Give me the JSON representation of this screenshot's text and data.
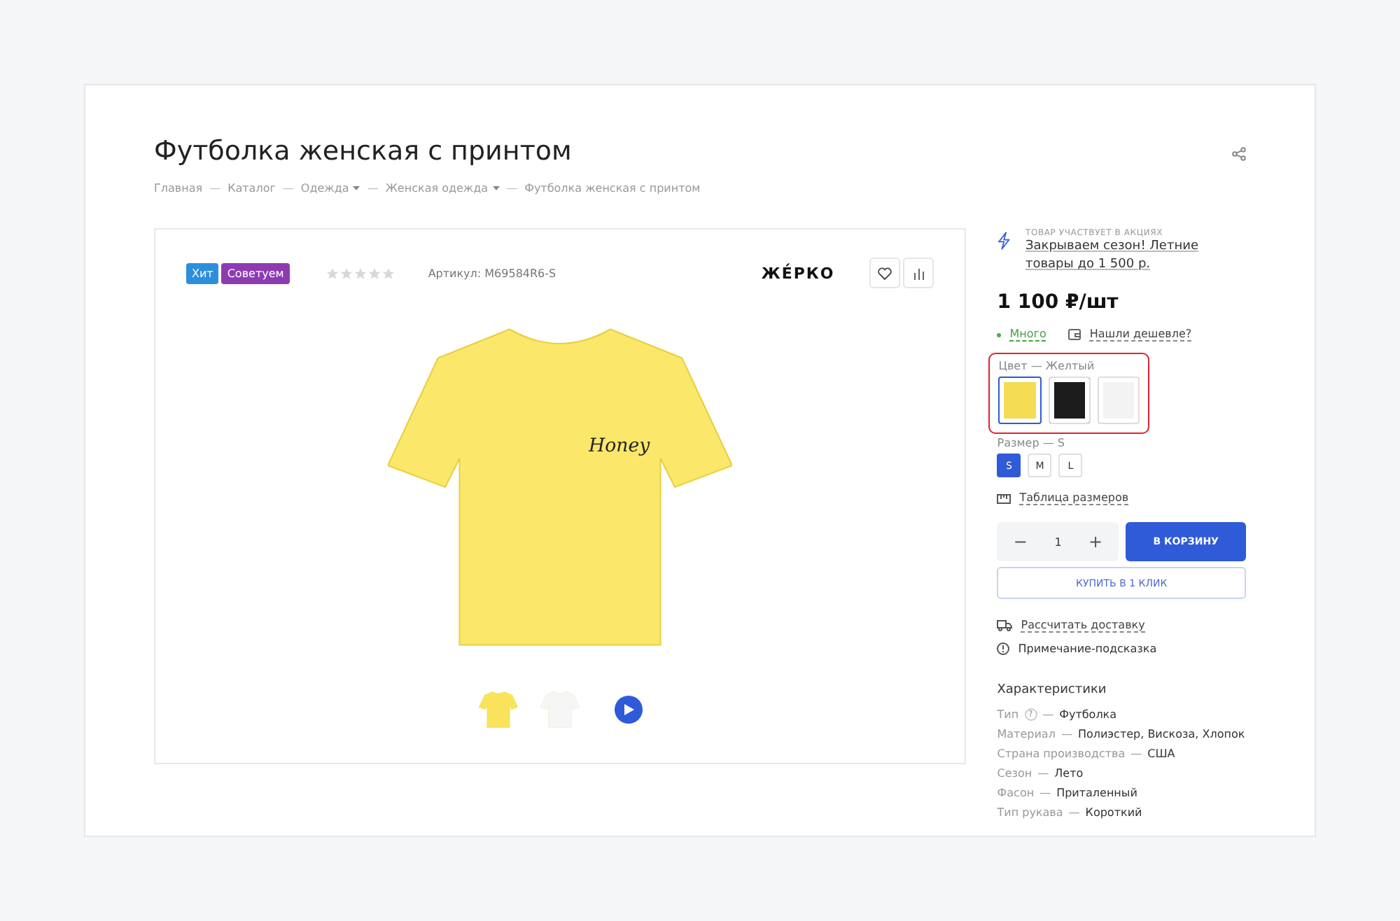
{
  "title": "Футболка женская с принтом",
  "breadcrumbs": [
    {
      "label": "Главная",
      "dropdown": false
    },
    {
      "separator": "—",
      "label": "Каталог",
      "dropdown": false
    },
    {
      "separator": "—",
      "label": "Одежда",
      "dropdown": true
    },
    {
      "separator": "—",
      "label": "Женская одежда",
      "dropdown": true
    },
    {
      "separator": "—",
      "label": "Футболка женская с принтом",
      "dropdown": false
    }
  ],
  "badges": [
    {
      "label": "Хит",
      "color": "#2d8fdc"
    },
    {
      "label": "Советуем",
      "color": "#8e3bb3"
    }
  ],
  "rating": {
    "stars": 0
  },
  "article": "Артикул: M69584R6-S",
  "brand": "ЖЕ́РКО",
  "product_image": {
    "print_text": "Honey"
  },
  "thumbnails": [
    {
      "kind": "image",
      "color": "#f8e35a",
      "selected": false
    },
    {
      "kind": "image",
      "color": "#f6f6f6",
      "selected": false
    },
    {
      "kind": "video",
      "selected": false
    }
  ],
  "promo": {
    "caption": "ТОВАР УЧАСТВУЕТ В АКЦИЯХ",
    "link": "Закрываем сезон! Летние товары до 1 500 р."
  },
  "price": "1 100 ₽/шт",
  "stock": "Много",
  "cheaper_link": "Нашли дешевле?",
  "color_option": {
    "label": "Цвет",
    "separator": "—",
    "value": "Желтый",
    "highlighted": true,
    "swatches": [
      {
        "color": "#f4dc54",
        "selected": true
      },
      {
        "color": "#1c1c1c",
        "selected": false
      },
      {
        "color": "#f3f3f3",
        "selected": false
      }
    ]
  },
  "size_option": {
    "label": "Размер",
    "separator": "—",
    "value": "S",
    "sizes": [
      {
        "label": "S",
        "selected": true
      },
      {
        "label": "M",
        "selected": false
      },
      {
        "label": "L",
        "selected": false
      }
    ]
  },
  "size_table_link": "Таблица размеров",
  "quantity": {
    "minus": "−",
    "value": "1",
    "plus": "+"
  },
  "cart_button": "В КОРЗИНУ",
  "one_click_button": "КУПИТЬ В 1 КЛИК",
  "delivery_link": "Рассчитать доставку",
  "hint_note": "Примечание-подсказка",
  "characteristics": {
    "title": "Характеристики",
    "rows": [
      {
        "label": "Тип",
        "help": "?",
        "separator": "—",
        "value": "Футболка"
      },
      {
        "label": "Материал",
        "separator": "—",
        "value": "Полиэстер, Вискоза, Хлопок"
      },
      {
        "label": "Страна производства",
        "separator": "—",
        "value": "США"
      },
      {
        "label": "Сезон",
        "separator": "—",
        "value": "Лето"
      },
      {
        "label": "Фасон",
        "separator": "—",
        "value": "Приталенный"
      },
      {
        "label": "Тип рукава",
        "separator": "—",
        "value": "Короткий"
      }
    ]
  }
}
